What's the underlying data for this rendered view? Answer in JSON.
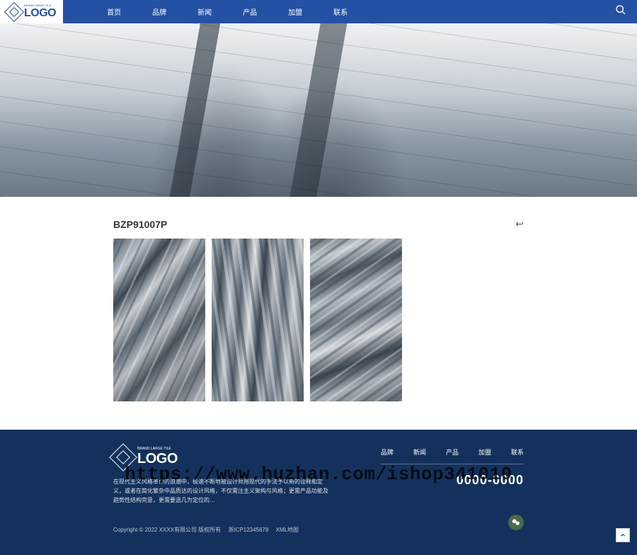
{
  "header": {
    "logo_text": "LOGO",
    "logo_sub": "BRAND LARGE TILE",
    "nav": [
      "首页",
      "品牌",
      "新闻",
      "产品",
      "加盟",
      "联系"
    ]
  },
  "product": {
    "title": "BZP91007P"
  },
  "footer": {
    "logo_text": "LOGO",
    "logo_sub": "BRAND LARGE TILE",
    "nav": [
      "品牌",
      "新闻",
      "产品",
      "加盟",
      "联系"
    ],
    "desc": "在现代主义风格革命的浪潮中，极速不断地被设计师用现代的手法予以新的诠释和定义，或者在简化繁杂中品质达的设计风格，不仅需注主义架构与风格；更需产品功能及趋势性结构完意，更需要选几为定位的…",
    "phone": "0000-0000",
    "copyright": "Copyright © 2022 XXXX有限公司 版权所有",
    "icp": "浙ICP12345678",
    "xml": "XML地图"
  },
  "watermark": "https://www.huzhan.com/ishop341010"
}
